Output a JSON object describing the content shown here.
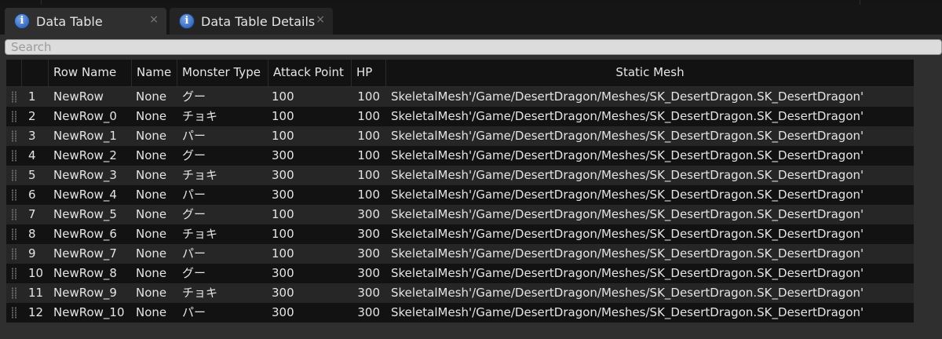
{
  "tabs": [
    {
      "label": "Data Table",
      "icon": "info-icon",
      "active": true
    },
    {
      "label": "Data Table Details",
      "icon": "info-icon",
      "active": false
    }
  ],
  "close_glyph": "×",
  "search": {
    "placeholder": "Search",
    "value": ""
  },
  "table": {
    "columns": [
      "",
      "Row Name",
      "Name",
      "Monster Type",
      "Attack Point",
      "HP",
      "Static Mesh"
    ],
    "rows": [
      [
        "1",
        "NewRow",
        "None",
        "グー",
        "100",
        "100",
        "SkeletalMesh'/Game/DesertDragon/Meshes/SK_DesertDragon.SK_DesertDragon'"
      ],
      [
        "2",
        "NewRow_0",
        "None",
        "チョキ",
        "100",
        "100",
        "SkeletalMesh'/Game/DesertDragon/Meshes/SK_DesertDragon.SK_DesertDragon'"
      ],
      [
        "3",
        "NewRow_1",
        "None",
        "パー",
        "100",
        "100",
        "SkeletalMesh'/Game/DesertDragon/Meshes/SK_DesertDragon.SK_DesertDragon'"
      ],
      [
        "4",
        "NewRow_2",
        "None",
        "グー",
        "300",
        "100",
        "SkeletalMesh'/Game/DesertDragon/Meshes/SK_DesertDragon.SK_DesertDragon'"
      ],
      [
        "5",
        "NewRow_3",
        "None",
        "チョキ",
        "300",
        "100",
        "SkeletalMesh'/Game/DesertDragon/Meshes/SK_DesertDragon.SK_DesertDragon'"
      ],
      [
        "6",
        "NewRow_4",
        "None",
        "パー",
        "300",
        "100",
        "SkeletalMesh'/Game/DesertDragon/Meshes/SK_DesertDragon.SK_DesertDragon'"
      ],
      [
        "7",
        "NewRow_5",
        "None",
        "グー",
        "100",
        "300",
        "SkeletalMesh'/Game/DesertDragon/Meshes/SK_DesertDragon.SK_DesertDragon'"
      ],
      [
        "8",
        "NewRow_6",
        "None",
        "チョキ",
        "100",
        "300",
        "SkeletalMesh'/Game/DesertDragon/Meshes/SK_DesertDragon.SK_DesertDragon'"
      ],
      [
        "9",
        "NewRow_7",
        "None",
        "パー",
        "100",
        "300",
        "SkeletalMesh'/Game/DesertDragon/Meshes/SK_DesertDragon.SK_DesertDragon'"
      ],
      [
        "10",
        "NewRow_8",
        "None",
        "グー",
        "300",
        "300",
        "SkeletalMesh'/Game/DesertDragon/Meshes/SK_DesertDragon.SK_DesertDragon'"
      ],
      [
        "11",
        "NewRow_9",
        "None",
        "チョキ",
        "300",
        "300",
        "SkeletalMesh'/Game/DesertDragon/Meshes/SK_DesertDragon.SK_DesertDragon'"
      ],
      [
        "12",
        "NewRow_10",
        "None",
        "パー",
        "300",
        "300",
        "SkeletalMesh'/Game/DesertDragon/Meshes/SK_DesertDragon.SK_DesertDragon'"
      ]
    ]
  },
  "colors": {
    "background": "#1c1c1c",
    "panel": "#2f2f2f",
    "header": "#121212",
    "row_odd": "#262626",
    "row_even": "#121212",
    "tab_icon": "#3d6fc2"
  }
}
